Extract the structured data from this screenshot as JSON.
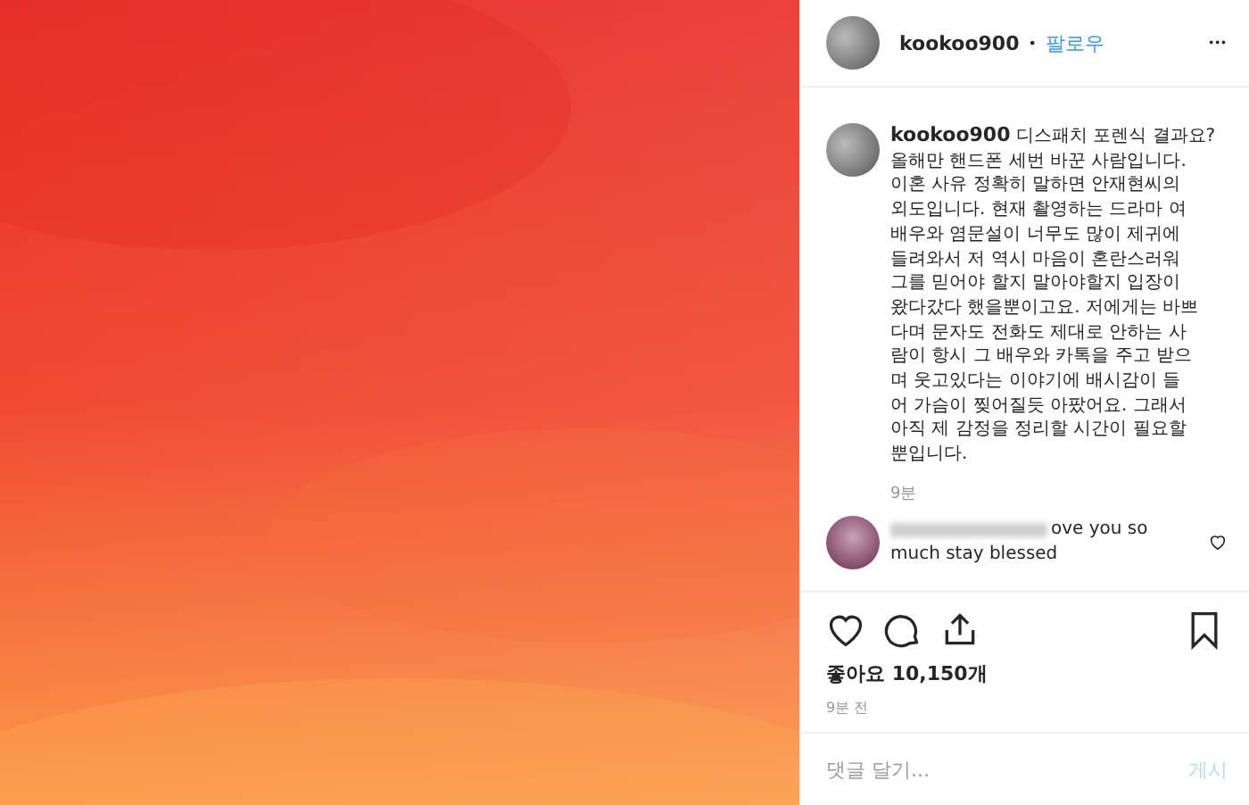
{
  "header": {
    "username": "kookoo900",
    "separator": "•",
    "follow": "팔로우",
    "more": "•••"
  },
  "caption": {
    "username": "kookoo900",
    "text": "디스패치 포렌식 결과요?\n올해만 핸드폰 세번 바꾼 사람입니다.\n이혼 사유 정확히 말하면 안재현씨의\n외도입니다. 현재 촬영하는 드라마 여\n배우와 염문설이 너무도 많이 제귀에\n들려와서 저 역시 마음이 혼란스러워\n그를 믿어야 할지 말아야할지 입장이\n왔다갔다 했을뿐이고요. 저에게는 바쁘\n다며 문자도 전화도 제대로 안하는 사\n람이 항시 그 배우와 카톡을 주고 받으\n며 웃고있다는 이야기에 배시감이 들\n어 가슴이 찢어질듯 아팠어요. 그래서\n아직 제 감정을 정리할 시간이 필요할\n뿐입니다.",
    "time": "9분"
  },
  "comments": [
    {
      "text": "ove you so\nmuch stay blessed",
      "liked": false
    }
  ],
  "likes": "좋아요 10,150개",
  "posted": "9분 전",
  "saved": false,
  "comment_field": {
    "placeholder": "댓글 달기...",
    "submit": "게시"
  }
}
